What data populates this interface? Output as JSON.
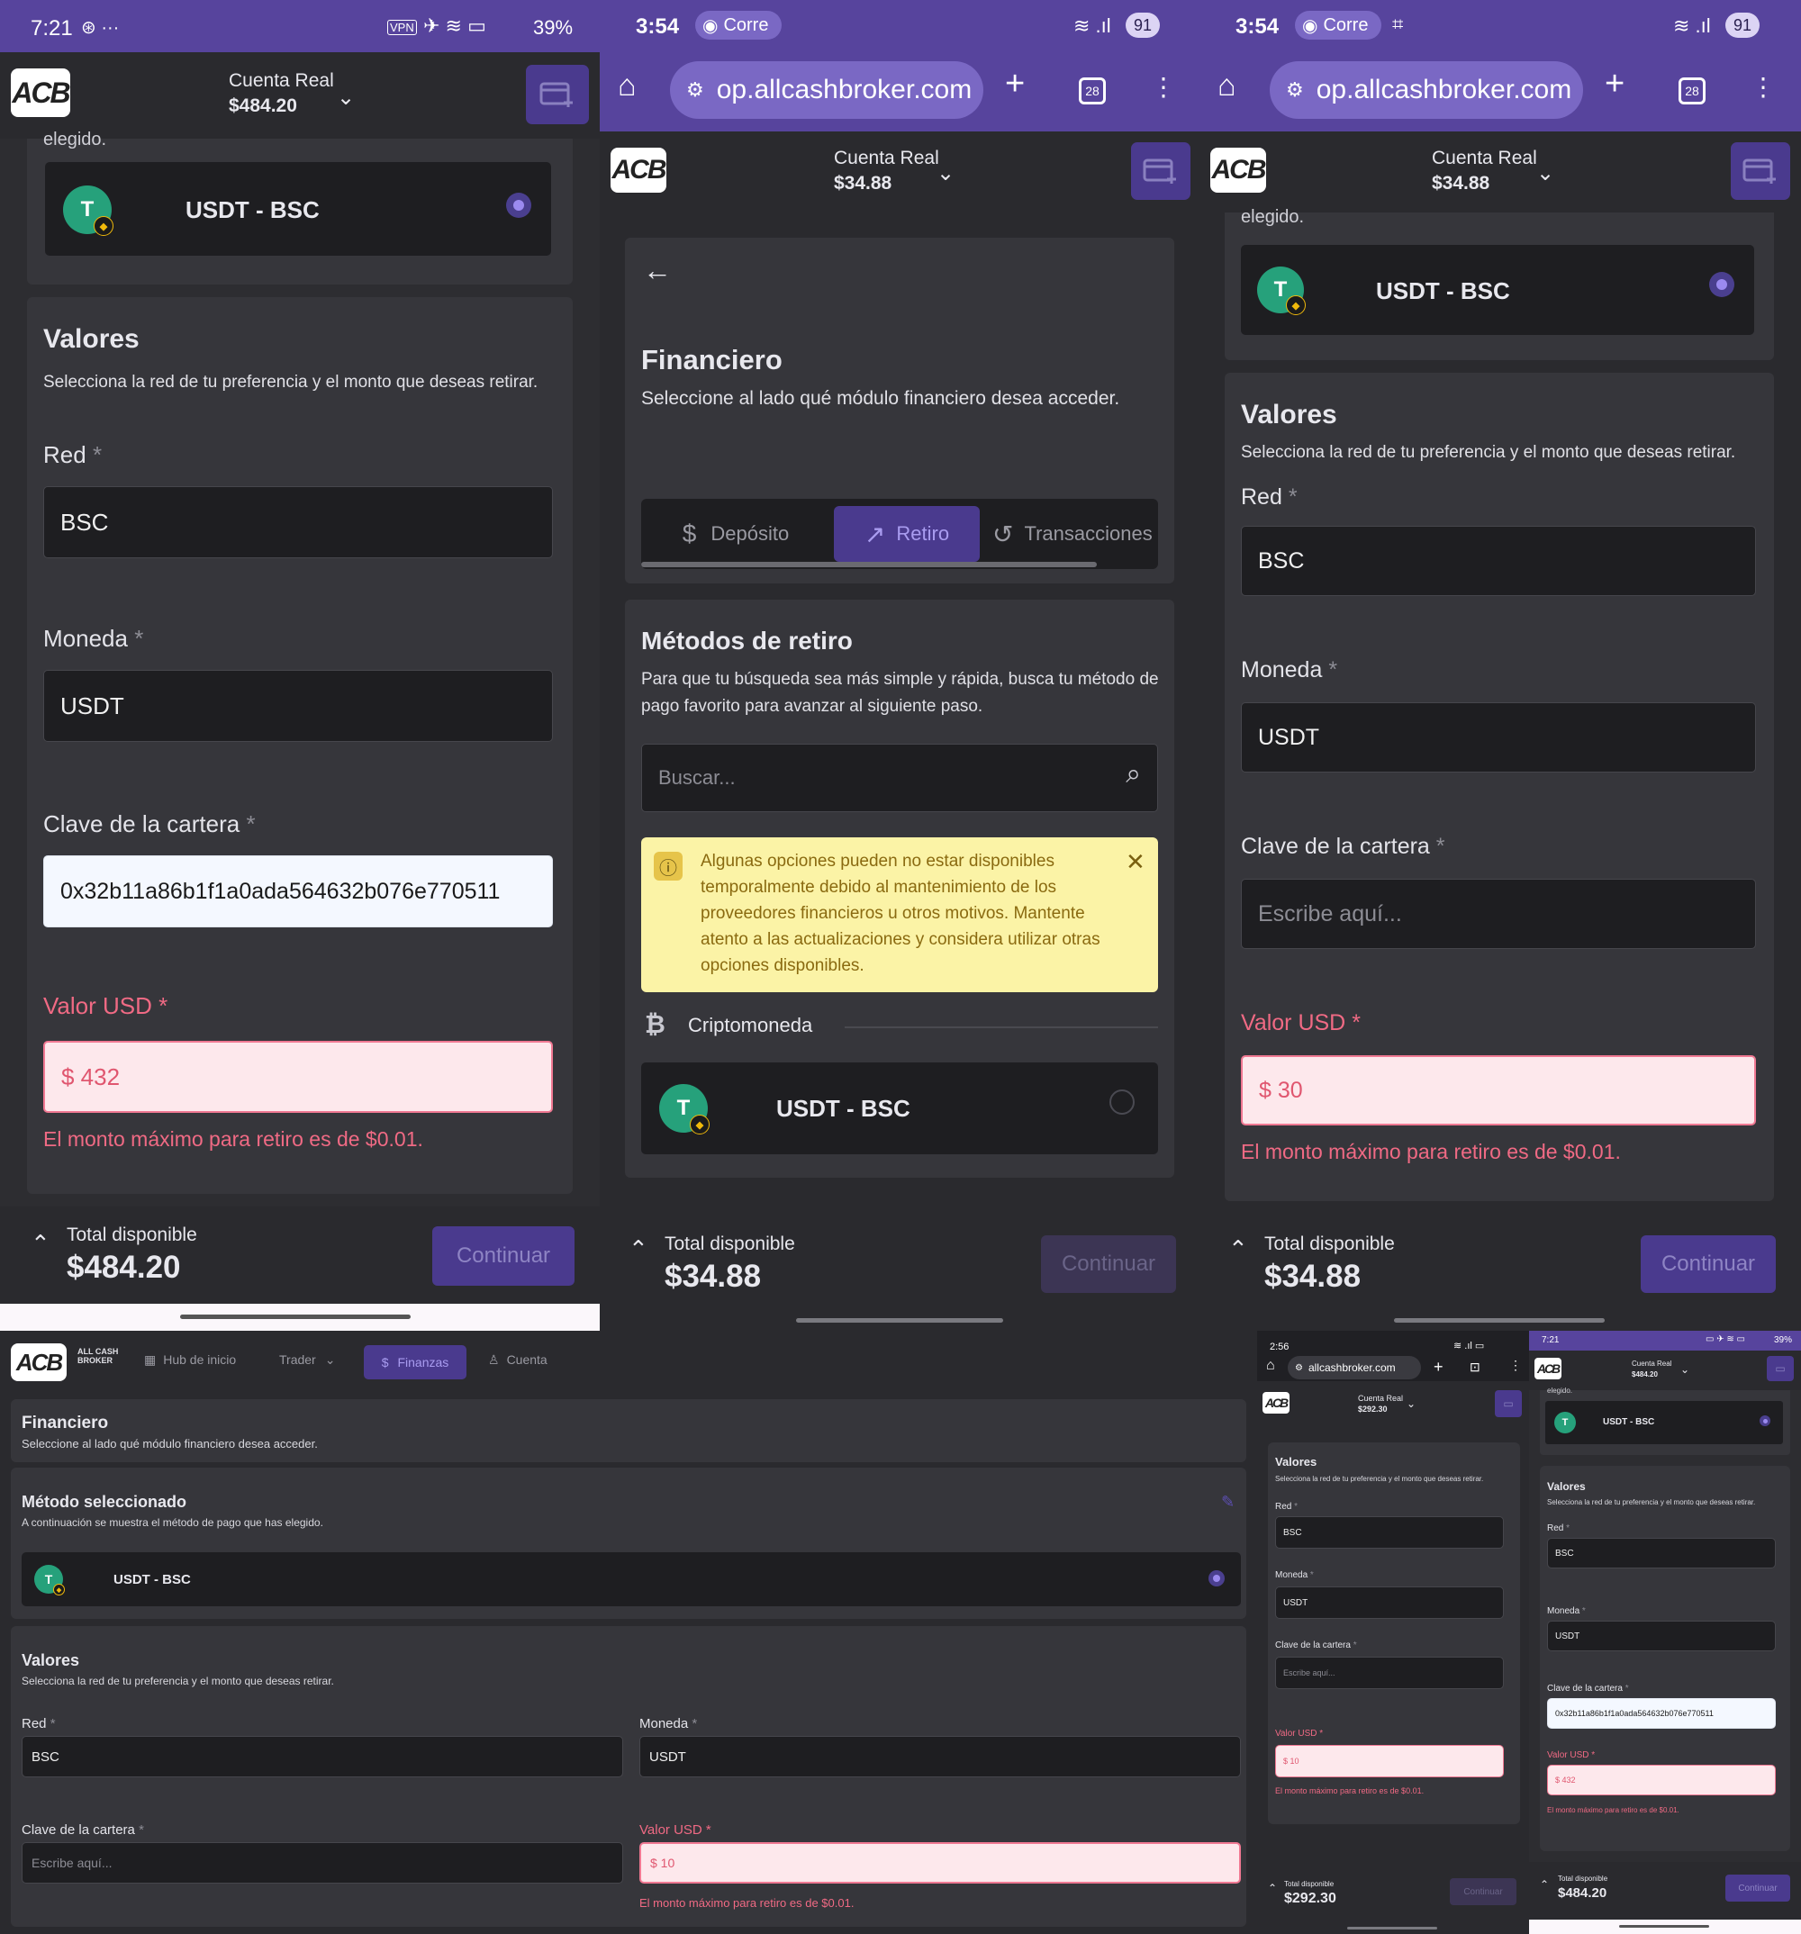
{
  "p1": {
    "status": {
      "time": "7:21",
      "battery": "39%",
      "vpn": "VPN"
    },
    "header": {
      "logo": "ACB",
      "account_label": "Cuenta Real",
      "balance": "$484.20"
    },
    "clipped_text": "elegido.",
    "method": {
      "name": "USDT - BSC",
      "icon": "T"
    },
    "valores": {
      "title": "Valores",
      "desc": "Selecciona la red de tu preferencia y el monto que deseas retirar.",
      "red_label": "Red",
      "red_value": "BSC",
      "moneda_label": "Moneda",
      "moneda_value": "USDT",
      "clave_label": "Clave de la cartera",
      "clave_value": "0x32b11a86b1f1a0ada564632b076e770511",
      "valor_label": "Valor USD",
      "valor_value": "$ 432",
      "error": "El monto máximo para retiro es de $0.01."
    },
    "footer": {
      "total_label": "Total disponible",
      "total": "$484.20",
      "continue": "Continuar"
    }
  },
  "p2": {
    "status": {
      "time": "3:54",
      "spotify": "Corre",
      "signal_badge": "91"
    },
    "browser": {
      "url": "op.allcashbroker.com",
      "tabs": "28"
    },
    "header": {
      "logo": "ACB",
      "account_label": "Cuenta Real",
      "balance": "$34.88"
    },
    "fin_title": "Financiero",
    "fin_desc": "Seleccione al lado qué módulo financiero desea acceder.",
    "tabs": [
      "Depósito",
      "Retiro",
      "Transacciones"
    ],
    "metodos_title": "Métodos de retiro",
    "metodos_desc": "Para que tu búsqueda sea más simple y rápida, busca tu método de pago favorito para avanzar al siguiente paso.",
    "search_placeholder": "Buscar...",
    "alert": "Algunas opciones pueden no estar disponibles temporalmente debido al mantenimiento de los proveedores financieros u otros motivos. Mantente atento a las actualizaciones y considera utilizar otras opciones disponibles.",
    "crypto_label": "Criptomoneda",
    "method": {
      "name": "USDT - BSC"
    },
    "footer": {
      "total_label": "Total disponible",
      "total": "$34.88",
      "continue": "Continuar"
    }
  },
  "p3": {
    "status": {
      "time": "3:54",
      "spotify": "Corre",
      "signal_badge": "91"
    },
    "browser": {
      "url": "op.allcashbroker.com",
      "tabs": "28"
    },
    "header": {
      "logo": "ACB",
      "account_label": "Cuenta Real",
      "balance": "$34.88"
    },
    "clipped_text": "elegido.",
    "method": {
      "name": "USDT - BSC"
    },
    "valores": {
      "title": "Valores",
      "desc": "Selecciona la red de tu preferencia y el monto que deseas retirar.",
      "red_label": "Red",
      "red_value": "BSC",
      "moneda_label": "Moneda",
      "moneda_value": "USDT",
      "clave_label": "Clave de la cartera",
      "clave_placeholder": "Escribe aquí...",
      "valor_label": "Valor USD",
      "valor_value": "$ 30",
      "error": "El monto máximo para retiro es de $0.01."
    },
    "footer": {
      "total_label": "Total disponible",
      "total": "$34.88",
      "continue": "Continuar"
    }
  },
  "p4": {
    "nav": {
      "logo": "ACB",
      "logo_sub": "ALL CASH BROKER",
      "items": [
        "Hub de inicio",
        "Trader",
        "Finanzas",
        "Cuenta"
      ]
    },
    "fin_title": "Financiero",
    "fin_desc": "Seleccione al lado qué módulo financiero desea acceder.",
    "metodo_title": "Método seleccionado",
    "metodo_desc": "A continuación se muestra el método de pago que has elegido.",
    "method": {
      "name": "USDT - BSC"
    },
    "valores": {
      "title": "Valores",
      "desc": "Selecciona la red de tu preferencia y el monto que deseas retirar.",
      "red_label": "Red",
      "red_value": "BSC",
      "moneda_label": "Moneda",
      "moneda_value": "USDT",
      "clave_label": "Clave de la cartera",
      "clave_placeholder": "Escribe aquí...",
      "valor_label": "Valor USD",
      "valor_value": "$ 10",
      "error": "El monto máximo para retiro es de $0.01."
    }
  },
  "p5": {
    "status": {
      "time": "2:56"
    },
    "browser": {
      "url": "allcashbroker.com"
    },
    "header": {
      "logo": "ACB",
      "account_label": "Cuenta Real",
      "balance": "$292.30"
    },
    "valores": {
      "title": "Valores",
      "desc": "Selecciona la red de tu preferencia y el monto que deseas retirar.",
      "red_label": "Red",
      "red_value": "BSC",
      "moneda_label": "Moneda",
      "moneda_value": "USDT",
      "clave_label": "Clave de la cartera",
      "clave_placeholder": "Escribe aquí...",
      "valor_label": "Valor USD",
      "valor_value": "$ 10",
      "error": "El monto máximo para retiro es de $0.01."
    },
    "footer": {
      "total_label": "Total disponible",
      "total": "$292.30",
      "continue": "Continuar"
    }
  },
  "p6": {
    "status": {
      "time": "7:21",
      "battery": "39%"
    },
    "header": {
      "logo": "ACB",
      "account_label": "Cuenta Real",
      "balance": "$484.20"
    },
    "clipped_text": "elegido.",
    "method": {
      "name": "USDT - BSC"
    },
    "valores": {
      "title": "Valores",
      "desc": "Selecciona la red de tu preferencia y el monto que deseas retirar.",
      "red_label": "Red",
      "red_value": "BSC",
      "moneda_label": "Moneda",
      "moneda_value": "USDT",
      "clave_label": "Clave de la cartera",
      "clave_value": "0x32b11a86b1f1a0ada564632b076e770511",
      "valor_label": "Valor USD",
      "valor_value": "$ 432",
      "error": "El monto máximo para retiro es de $0.01."
    },
    "footer": {
      "total_label": "Total disponible",
      "total": "$484.20",
      "continue": "Continuar"
    }
  },
  "colors": {
    "accent": "#4a3a8e",
    "statusbar": "#57449d",
    "error": "#f06a84",
    "tether": "#26a17b",
    "alert_bg": "#fbf3a6"
  }
}
